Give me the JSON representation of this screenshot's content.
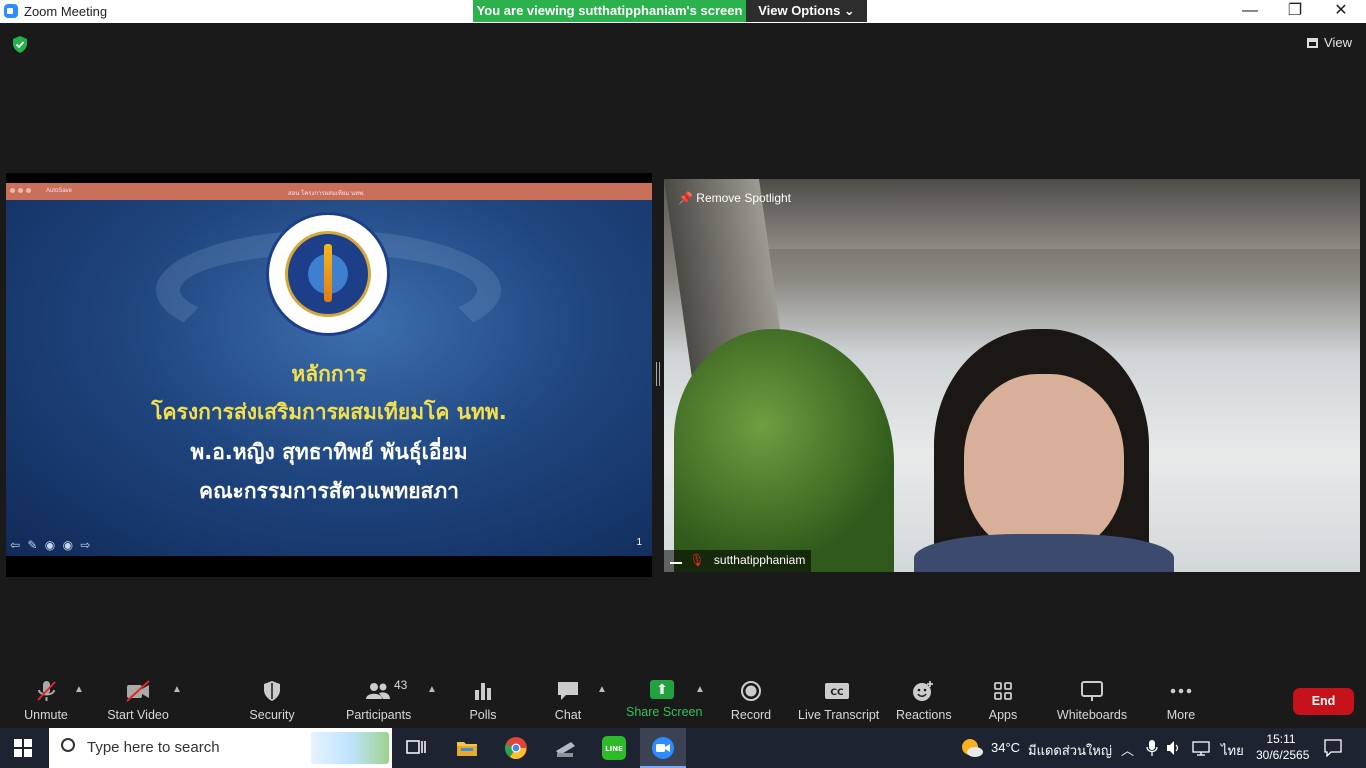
{
  "window": {
    "title": "Zoom Meeting",
    "viewing_banner": "You are viewing sutthatipphaniam's screen",
    "view_options": "View Options ⌄",
    "minimize": "—",
    "restore": "❐",
    "close": "✕"
  },
  "meeting": {
    "view_label": "View"
  },
  "shared_screen": {
    "app_bar": {
      "autosave": "AutoSave",
      "filename": "สอน โครงการผสมเทียม นทพ."
    },
    "slide": {
      "line1": "หลักการ",
      "line2": "โครงการส่งเสริมการผสมเทียมโค นทพ.",
      "line3": "พ.อ.หญิง สุทธาทิพย์  พันธุ์เอี่ยม",
      "line4": "คณะกรรมการสัตวแพทยสภา",
      "page_number": "1"
    }
  },
  "video": {
    "spotlight_label": "Remove Spotlight",
    "participant_name": "sutthatipphaniam"
  },
  "toolbar": {
    "unmute": "Unmute",
    "start_video": "Start Video",
    "security": "Security",
    "participants": "Participants",
    "participants_count": "43",
    "polls": "Polls",
    "chat": "Chat",
    "share_screen": "Share Screen",
    "record": "Record",
    "live_transcript": "Live Transcript",
    "reactions": "Reactions",
    "apps": "Apps",
    "whiteboards": "Whiteboards",
    "more": "More",
    "end": "End"
  },
  "taskbar": {
    "search_placeholder": "Type here to search",
    "weather_temp": "34°C",
    "weather_desc": "มีแดดส่วนใหญ่",
    "language": "ไทย",
    "time": "15:11",
    "date": "30/6/2565"
  },
  "colors": {
    "share_green": "#2bb24c",
    "end_red": "#c6131b",
    "slide_yellow": "#f4e04d"
  }
}
